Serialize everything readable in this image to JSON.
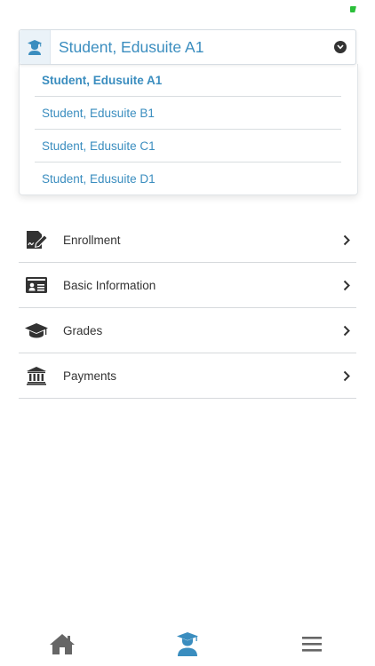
{
  "selector": {
    "current_label": "Student, Edusuite A1",
    "icon": "student-icon",
    "caret_icon": "chevron-down-circle-icon"
  },
  "dropdown": {
    "options": [
      {
        "label": "Student, Edusuite A1",
        "selected": true
      },
      {
        "label": "Student, Edusuite B1",
        "selected": false
      },
      {
        "label": "Student, Edusuite C1",
        "selected": false
      },
      {
        "label": "Student, Edusuite D1",
        "selected": false
      }
    ]
  },
  "menu": {
    "items": [
      {
        "label": "Enrollment",
        "icon": "signature-edit-icon"
      },
      {
        "label": "Basic Information",
        "icon": "id-card-icon"
      },
      {
        "label": "Grades",
        "icon": "graduation-cap-icon"
      },
      {
        "label": "Payments",
        "icon": "bank-icon"
      }
    ]
  },
  "bottom_nav": {
    "items": [
      {
        "name": "home",
        "icon": "home-icon",
        "active": false
      },
      {
        "name": "student",
        "icon": "student-icon",
        "active": true
      },
      {
        "name": "menu",
        "icon": "hamburger-menu-icon",
        "active": false
      }
    ]
  },
  "colors": {
    "accent": "#3a8dbf",
    "icon_dark": "#333333",
    "nav_inactive": "#666666",
    "status_indicator": "#2bbf3a"
  }
}
